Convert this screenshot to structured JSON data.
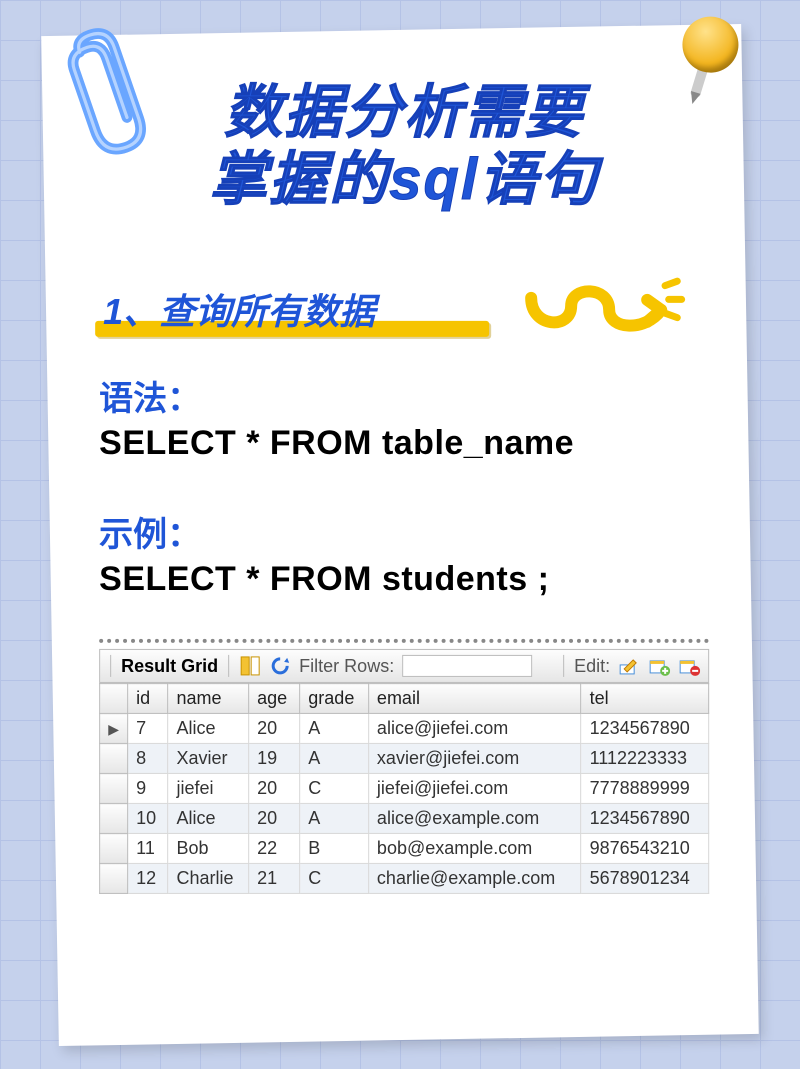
{
  "title": {
    "line1": "数据分析需要",
    "line2": "掌握的sql语句"
  },
  "section": "1、查询所有数据",
  "syntax": {
    "label": "语法：",
    "code": "SELECT * FROM table_name"
  },
  "example": {
    "label": "示例：",
    "code": "SELECT * FROM students ;"
  },
  "resultgrid": {
    "label": "Result Grid",
    "filter_label": "Filter Rows:",
    "filter_value": "",
    "filter_placeholder": "",
    "edit_label": "Edit:",
    "columns": [
      "id",
      "name",
      "age",
      "grade",
      "email",
      "tel"
    ],
    "rows": [
      {
        "id": "7",
        "name": "Alice",
        "age": "20",
        "grade": "A",
        "email": "alice@jiefei.com",
        "tel": "1234567890"
      },
      {
        "id": "8",
        "name": "Xavier",
        "age": "19",
        "grade": "A",
        "email": "xavier@jiefei.com",
        "tel": "1112223333"
      },
      {
        "id": "9",
        "name": "jiefei",
        "age": "20",
        "grade": "C",
        "email": "jiefei@jiefei.com",
        "tel": "7778889999"
      },
      {
        "id": "10",
        "name": "Alice",
        "age": "20",
        "grade": "A",
        "email": "alice@example.com",
        "tel": "1234567890"
      },
      {
        "id": "11",
        "name": "Bob",
        "age": "22",
        "grade": "B",
        "email": "bob@example.com",
        "tel": "9876543210"
      },
      {
        "id": "12",
        "name": "Charlie",
        "age": "21",
        "grade": "C",
        "email": "charlie@example.com",
        "tel": "5678901234"
      }
    ]
  }
}
